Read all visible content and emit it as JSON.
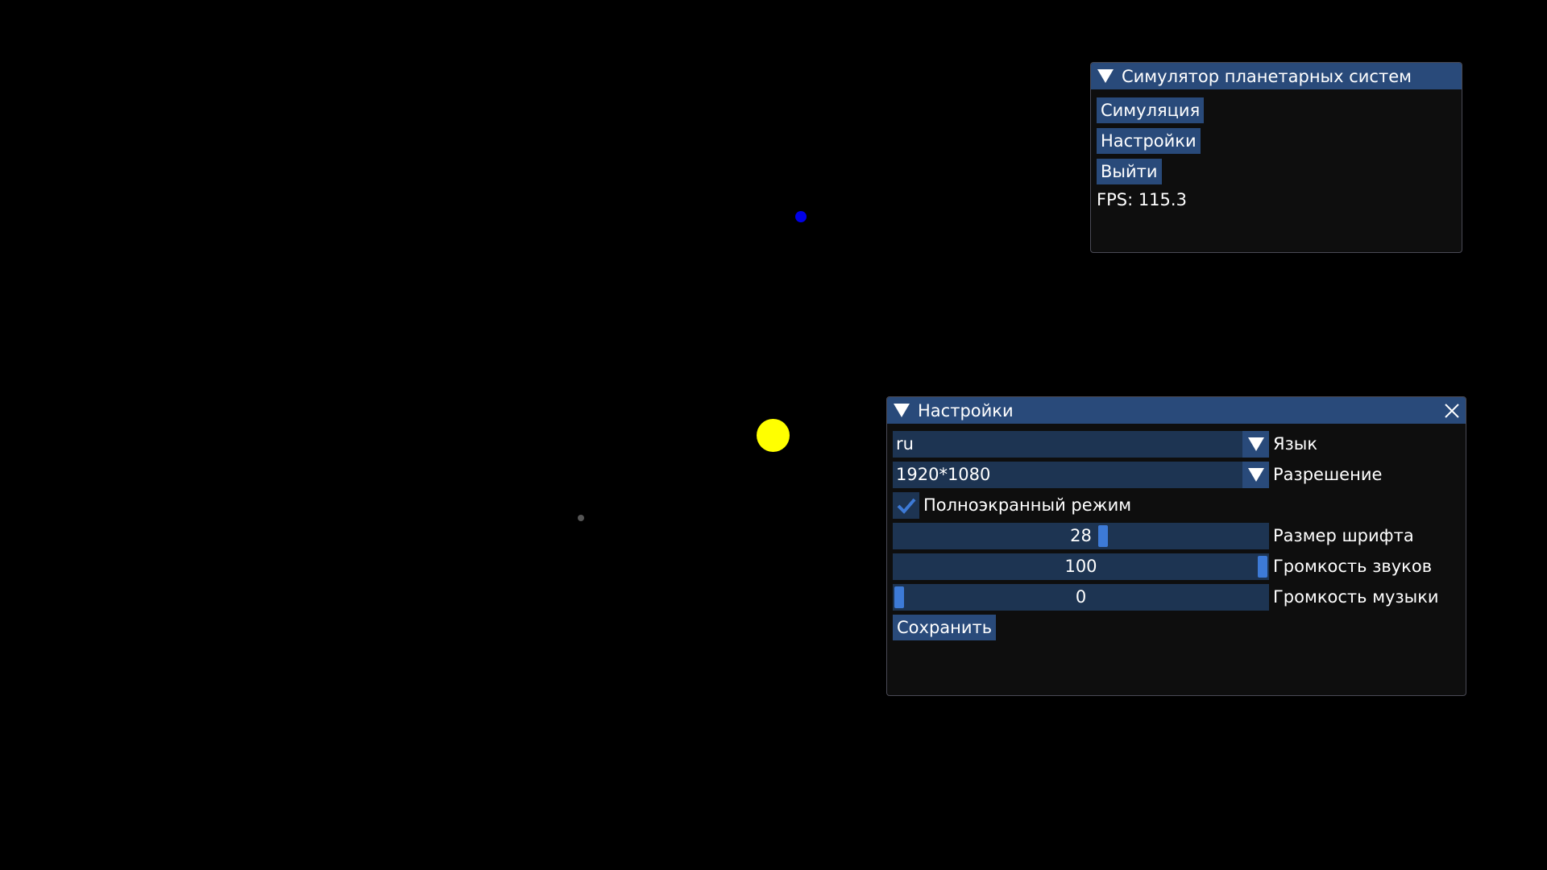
{
  "colors": {
    "background": "#000000",
    "sun": "#ffff00",
    "planet_blue": "#0000e6",
    "planet_grey": "#555555",
    "title_bar": "#294a7a",
    "frame": "#1d3452",
    "slider_grab": "#3d7ad6"
  },
  "main_window": {
    "title": "Симулятор планетарных систем",
    "buttons": {
      "simulation": "Симуляция",
      "settings": "Настройки",
      "exit": "Выйти"
    },
    "fps_text": "FPS: 115.3"
  },
  "settings_window": {
    "title": "Настройки",
    "language": {
      "value": "ru",
      "label": "Язык"
    },
    "resolution": {
      "value": "1920*1080",
      "label": "Разрешение"
    },
    "fullscreen": {
      "checked": true,
      "label": "Полноэкранный режим"
    },
    "font_size": {
      "value": "28",
      "label": "Размер шрифта",
      "fraction": 0.56
    },
    "sound_volume": {
      "value": "100",
      "label": "Громкость звуков",
      "fraction": 1.0
    },
    "music_volume": {
      "value": "0",
      "label": "Громкость музыки",
      "fraction": 0.0
    },
    "save_button": "Сохранить"
  }
}
